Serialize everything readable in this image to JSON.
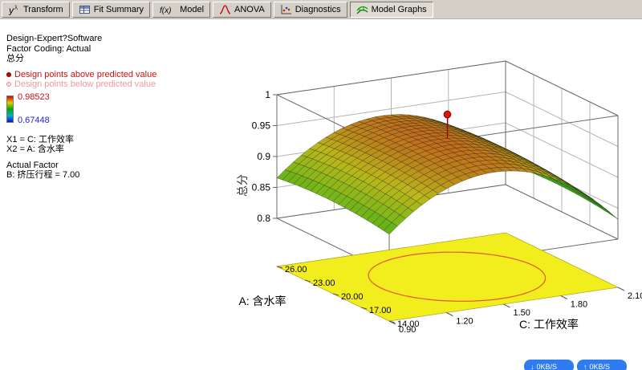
{
  "toolbar": {
    "buttons": [
      {
        "label": "Transform",
        "icon": "y-lambda-icon"
      },
      {
        "label": "Fit Summary",
        "icon": "summary-table-icon"
      },
      {
        "label": "Model",
        "icon": "fx-icon"
      },
      {
        "label": "ANOVA",
        "icon": "bell-curve-icon"
      },
      {
        "label": "Diagnostics",
        "icon": "diagnostics-plot-icon"
      },
      {
        "label": "Model Graphs",
        "icon": "surface-graph-icon",
        "active": true
      }
    ]
  },
  "info_panel": {
    "title": "Design-Expert?Software",
    "factor_coding": "Factor Coding: Actual",
    "response": "总分",
    "legend_above": "Design points above predicted value",
    "legend_below": "Design points below predicted value",
    "scale_max": "0.98523",
    "scale_min": "0.67448",
    "x1": "X1 = C: 工作效率",
    "x2": "X2 = A: 含水率",
    "actual_factor_label": "Actual Factor",
    "actual_factor_value": "B: 挤压行程 = 7.00"
  },
  "status_overlay": {
    "down": "0KB/S",
    "up": "0KB/S"
  },
  "chart_data": {
    "type": "surface3d",
    "title": "",
    "z_axis": {
      "label": "总分",
      "min": 0.8,
      "max": 1.0,
      "ticks": [
        "1",
        "0.95",
        "0.9",
        "0.85",
        "0.8"
      ],
      "tick_values": [
        1,
        0.95,
        0.9,
        0.85,
        0.8
      ]
    },
    "a_axis": {
      "label": "A: 含水率",
      "min": 14,
      "max": 26,
      "ticks": [
        "26.00",
        "23.00",
        "20.00",
        "17.00",
        "14.00"
      ],
      "tick_values": [
        26,
        23,
        20,
        17,
        14
      ]
    },
    "c_axis": {
      "label": "C: 工作效率",
      "min": 0.9,
      "max": 2.1,
      "ticks": [
        "0.90",
        "1.20",
        "1.50",
        "1.80",
        "2.10"
      ],
      "tick_values": [
        0.9,
        1.2,
        1.5,
        1.8,
        2.1
      ]
    },
    "color_scale": {
      "min": 0.67448,
      "max": 0.98523,
      "min_color": "#1010d8",
      "max_color": "#e00000"
    },
    "surface_model": {
      "description": "z = z_peak - kc*((c-c_peak)/c_range)^2 - ka*((a-a_peak)/a_range)^2",
      "z_peak": 0.947,
      "c_peak": 1.45,
      "kc": 0.36,
      "a_peak": 20.6,
      "ka": 0.03
    },
    "design_points": [
      {
        "a": 20,
        "c": 1.5,
        "value": 0.985,
        "position": "above"
      }
    ],
    "floor_contour": {
      "fill": "#f2ee1e",
      "contour_color": "#e0582a",
      "center_a": 19.8,
      "radius_a": 4.8,
      "center_c": 1.54,
      "radius_c": 0.4
    }
  }
}
